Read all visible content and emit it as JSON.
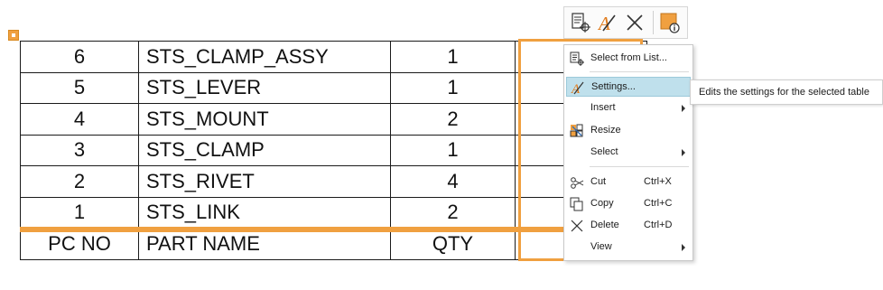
{
  "table": {
    "rows": [
      {
        "pc_no": "6",
        "part_name": "STS_CLAMP_ASSY",
        "qty": "1"
      },
      {
        "pc_no": "5",
        "part_name": "STS_LEVER",
        "qty": "1"
      },
      {
        "pc_no": "4",
        "part_name": "STS_MOUNT",
        "qty": "2"
      },
      {
        "pc_no": "3",
        "part_name": "STS_CLAMP",
        "qty": "1"
      },
      {
        "pc_no": "2",
        "part_name": "STS_RIVET",
        "qty": "4"
      },
      {
        "pc_no": "1",
        "part_name": "STS_LINK",
        "qty": "2"
      }
    ],
    "headers": {
      "pc_no": "PC NO",
      "part_name": "PART NAME",
      "qty": "QTY"
    }
  },
  "toolbar": {
    "icons": [
      "select-from-list-icon",
      "settings-icon",
      "delete-icon",
      "properties-icon"
    ]
  },
  "context_menu": {
    "items": [
      {
        "label": "Select from List...",
        "mnemonic": "S",
        "icon": "select-from-list-icon"
      },
      {
        "label": "Settings...",
        "mnemonic": "S",
        "icon": "settings-icon",
        "highlighted": true
      },
      {
        "label": "Insert",
        "submenu": true
      },
      {
        "label": "Resize",
        "icon": "resize-icon"
      },
      {
        "label": "Select",
        "submenu": true
      },
      {
        "label": "Cut",
        "shortcut": "Ctrl+X",
        "icon": "scissors-icon"
      },
      {
        "label": "Copy",
        "shortcut": "Ctrl+C",
        "icon": "copy-icon"
      },
      {
        "label": "Delete",
        "shortcut": "Ctrl+D",
        "icon": "delete-icon"
      },
      {
        "label": "View",
        "submenu": true
      }
    ]
  },
  "tooltip": {
    "text": "Edits the settings for the selected table"
  },
  "colors": {
    "selection": "#f0a040",
    "highlight": "#bfe0ec"
  }
}
